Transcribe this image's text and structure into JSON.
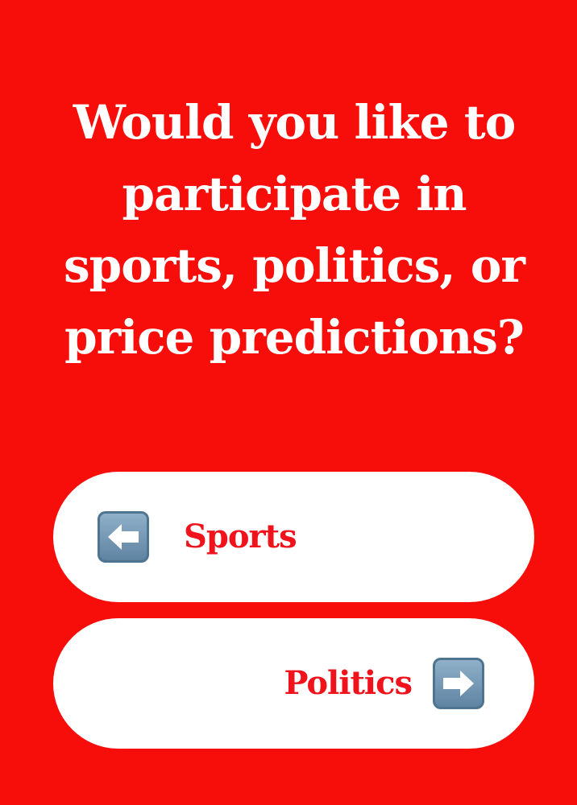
{
  "question": "Would you like to participate in sports, politics, or price predictions?",
  "options": [
    {
      "label": "Sports",
      "icon": "left-arrow-icon"
    },
    {
      "label": "Politics",
      "icon": "right-arrow-icon"
    }
  ],
  "colors": {
    "background": "#f70d0a",
    "button_background": "#ffffff",
    "button_text": "#f0131b",
    "icon_background": "#6f93b0"
  }
}
